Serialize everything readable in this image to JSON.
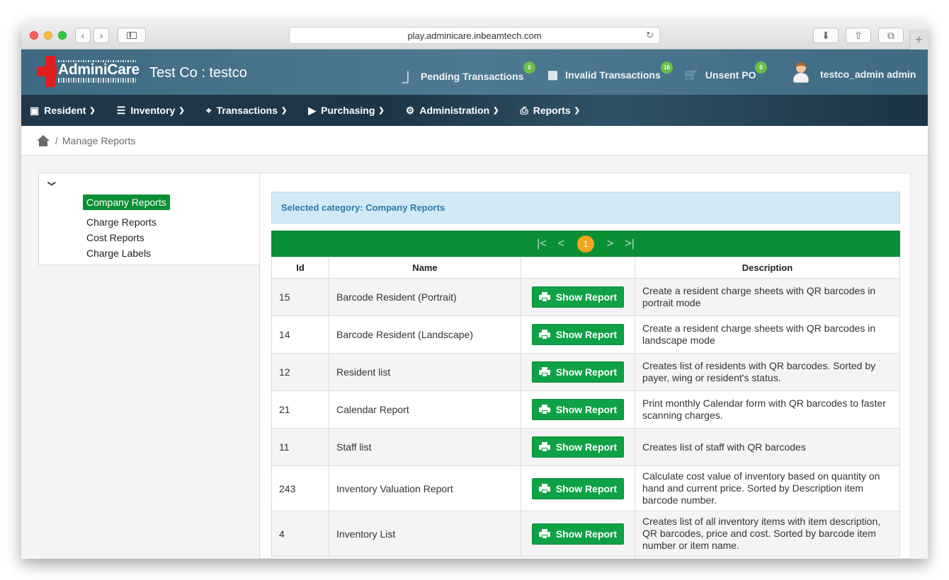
{
  "browser": {
    "url": "play.adminicare.inbeamtech.com",
    "back_glyph": "‹",
    "forward_glyph": "›",
    "reload_glyph": "↻",
    "download_glyph": "⬇",
    "share_glyph": "⇧",
    "tabs_glyph": "⧉",
    "newtab_glyph": "+"
  },
  "header": {
    "logo_text": "AdminiCare",
    "company": "Test Co : testco",
    "pending": {
      "label": "Pending Transactions",
      "count": "0",
      "icon": "inbox-icon"
    },
    "invalid": {
      "label": "Invalid Transactions",
      "count": "16",
      "icon": "gift-icon"
    },
    "unsent": {
      "label": "Unsent PO",
      "count": "0",
      "icon": "cart-icon"
    },
    "user": "testco_admin admin"
  },
  "nav": {
    "items": [
      {
        "label": "Resident",
        "icon": "id-card-icon"
      },
      {
        "label": "Inventory",
        "icon": "list-icon"
      },
      {
        "label": "Transactions",
        "icon": "crop-icon"
      },
      {
        "label": "Purchasing",
        "icon": "purchase-icon"
      },
      {
        "label": "Administration",
        "icon": "settings-icon"
      },
      {
        "label": "Reports",
        "icon": "printer-icon"
      }
    ]
  },
  "breadcrumb": {
    "separator": "/",
    "current": "Manage Reports"
  },
  "tree": {
    "toggle": "⌄",
    "items": [
      "Company Reports",
      "Charge Reports",
      "Cost Reports",
      "Charge Labels"
    ],
    "selected": "Company Reports"
  },
  "panel": {
    "selected_category": "Selected category: Company Reports",
    "pager": {
      "first": "|<",
      "prev": "<",
      "current": "1",
      "next": ">",
      "last": ">|"
    },
    "columns": [
      "Id",
      "Name",
      "",
      "Description"
    ],
    "button_label": "Show Report",
    "rows": [
      {
        "id": "15",
        "name": "Barcode Resident (Portrait)",
        "description": "Create a resident charge sheets with QR barcodes in portrait mode"
      },
      {
        "id": "14",
        "name": "Barcode Resident (Landscape)",
        "description": "Create a resident charge sheets with QR barcodes in landscape mode"
      },
      {
        "id": "12",
        "name": "Resident list",
        "description": "Creates list of residents with QR barcodes. Sorted by payer, wing or resident's status."
      },
      {
        "id": "21",
        "name": "Calendar Report",
        "description": "Print monthly Calendar form with QR barcodes to faster scanning charges."
      },
      {
        "id": "11",
        "name": "Staff list",
        "description": "Creates list of staff with QR barcodes"
      },
      {
        "id": "243",
        "name": "Inventory Valuation Report",
        "description": "Calculate cost value of inventory based on quantity on hand and current price. Sorted by Description item barcode number."
      },
      {
        "id": "4",
        "name": "Inventory List",
        "description": "Creates list of all inventory items with item description, QR barcodes, price and cost. Sorted by barcode item number or item name."
      }
    ]
  },
  "colors": {
    "header_bg": "#4d7a92",
    "nav_bg": "#1d3546",
    "accent_green": "#0b8f34",
    "badge_green": "#6cc04a",
    "page_orange": "#f4a61c"
  }
}
